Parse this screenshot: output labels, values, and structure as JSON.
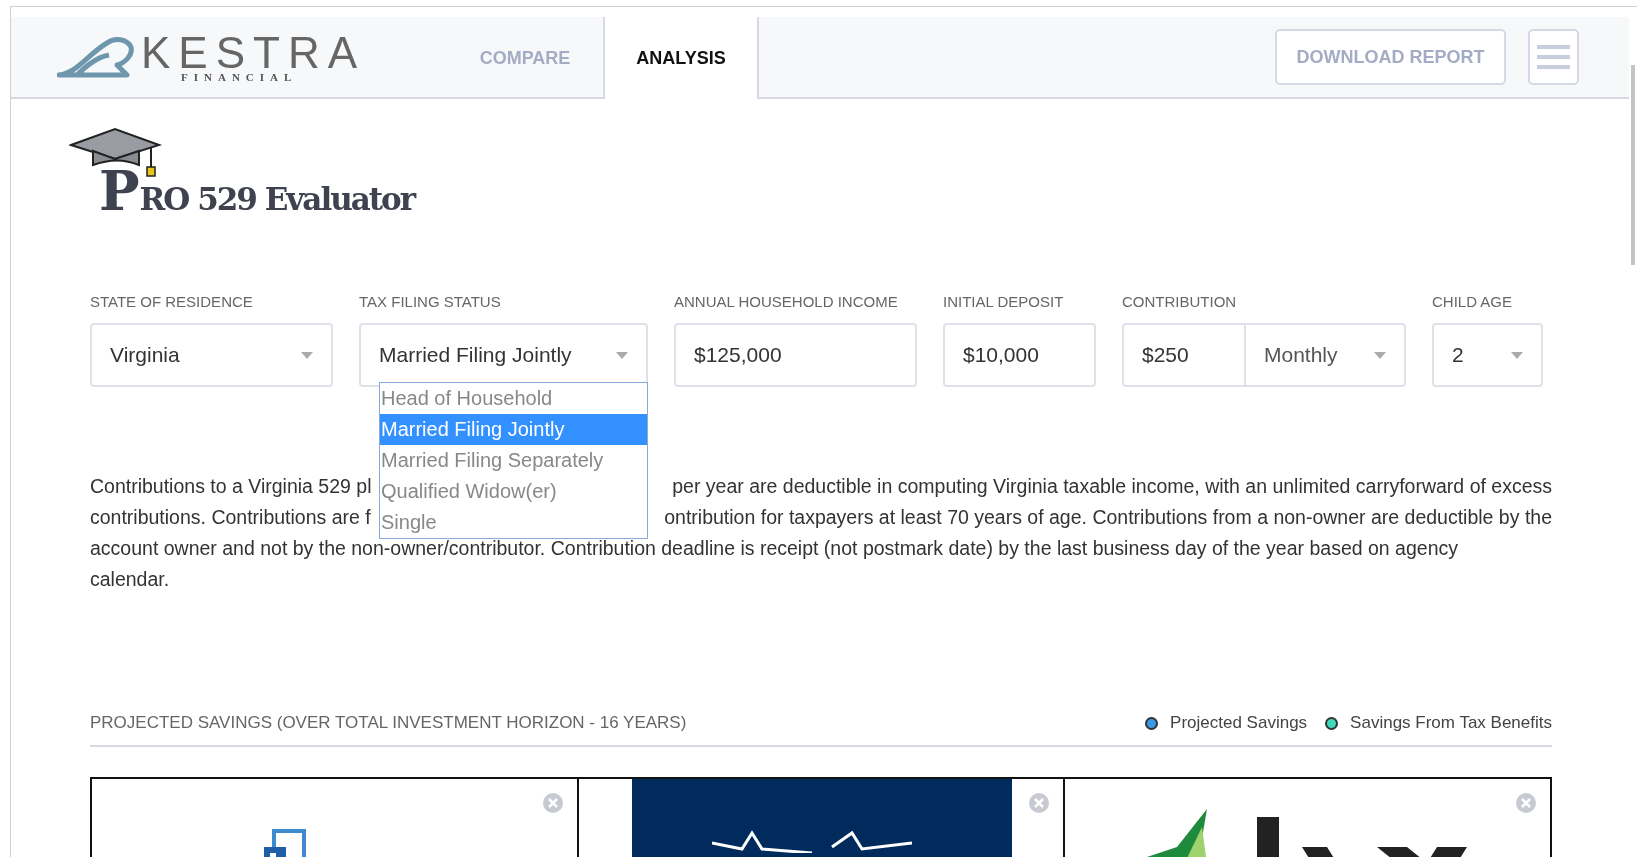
{
  "header": {
    "logo": {
      "name": "KESTRA",
      "sub": "FINANCIAL"
    },
    "tabs": [
      {
        "label": "COMPARE",
        "selected": false
      },
      {
        "label": "ANALYSIS",
        "selected": true
      }
    ],
    "download_button": "DOWNLOAD REPORT"
  },
  "title": {
    "initial": "P",
    "rest": "RO 529 Evaluator"
  },
  "fields": [
    {
      "label": "STATE OF RESIDENCE",
      "kind": "select",
      "value": "Virginia"
    },
    {
      "label": "TAX FILING STATUS",
      "kind": "select",
      "value": "Married Filing Jointly",
      "expanded": true,
      "options": [
        {
          "label": "Head of Household",
          "selected": false
        },
        {
          "label": "Married Filing Jointly",
          "selected": true
        },
        {
          "label": "Married Filing Separately",
          "selected": false
        },
        {
          "label": "Qualified Widow(er)",
          "selected": false
        },
        {
          "label": "Single",
          "selected": false
        }
      ]
    },
    {
      "label": "ANNUAL HOUSEHOLD INCOME",
      "kind": "input",
      "value": "$125,000"
    },
    {
      "label": "INITIAL DEPOSIT",
      "kind": "input",
      "value": "$10,000"
    },
    {
      "label": "CONTRIBUTION",
      "kind": "combo",
      "value": "$250",
      "option": "Monthly"
    },
    {
      "label": "CHILD AGE",
      "kind": "select",
      "value": "2"
    }
  ],
  "description_lines": [
    {
      "segments": [
        "Contributions to a Virginia 529 pl",
        "per year are deductible in computing Virginia taxable income, with an unlimited carryforward of excess"
      ]
    },
    {
      "segments": [
        "contributions. Contributions are f",
        "ontribution for taxpayers at least 70 years of age. Contributions from a non-owner are deductible by the"
      ]
    },
    {
      "segments": [
        "account owner and not by the non-owner/contributor. Contribution deadline is receipt (not postmark date) by the last business day of the year based on agency"
      ]
    },
    {
      "segments": [
        "calendar."
      ]
    }
  ],
  "savings": {
    "title": "PROJECTED SAVINGS (OVER TOTAL INVESTMENT HORIZON - 16 YEARS)",
    "legend": [
      {
        "label": "Projected Savings",
        "color": "#3b9ae6"
      },
      {
        "label": "Savings From Tax Benefits",
        "color": "#3fd9bf"
      }
    ]
  },
  "plan_cards": [
    {
      "kind": "squares"
    },
    {
      "kind": "navy"
    },
    {
      "kind": "green"
    }
  ]
}
